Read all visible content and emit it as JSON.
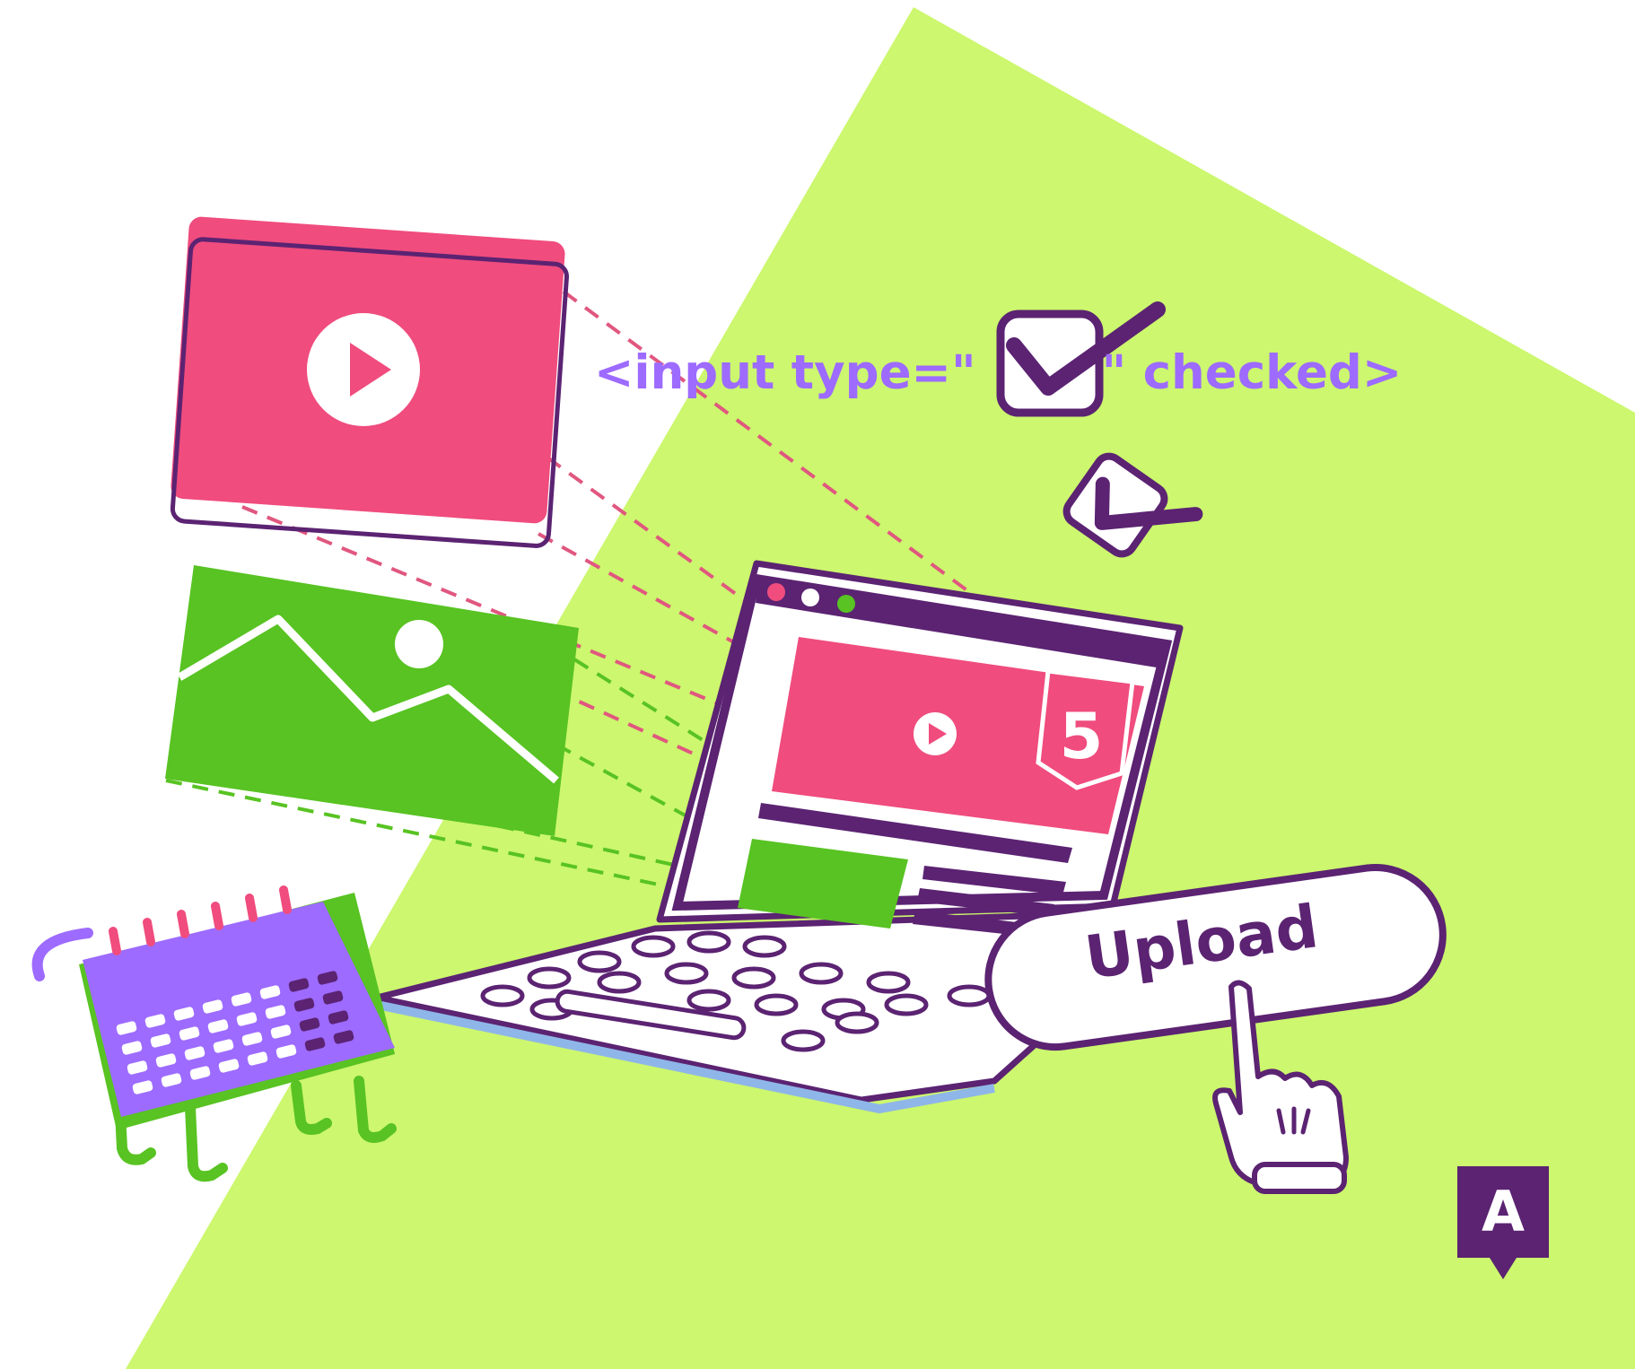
{
  "code_snippet": {
    "before_checkbox": "<input type=\"",
    "after_checkbox": "\" checked>"
  },
  "upload_button": {
    "label": "Upload"
  },
  "logo": {
    "letter": "A"
  },
  "html5_badge": {
    "digit": "5"
  },
  "colors": {
    "background_green": "#CCF76E",
    "purple_dark": "#5B2372",
    "purple_light": "#9D6BFF",
    "pink": "#F04C7E",
    "green": "#58C322",
    "white": "#FFFFFF"
  },
  "icons": [
    "video-thumbnail-icon",
    "image-thumbnail-icon",
    "play-icon",
    "checkbox-checked-icon",
    "laptop-icon",
    "html5-logo-icon",
    "calendar-icon",
    "pointing-hand-icon"
  ]
}
